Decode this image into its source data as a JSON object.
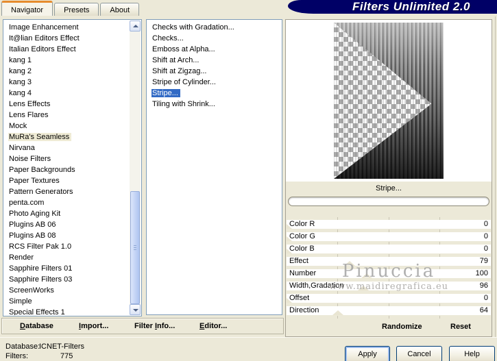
{
  "window": {
    "title": "Filters Unlimited 2.0"
  },
  "tabs": [
    {
      "label": "Navigator",
      "active": true
    },
    {
      "label": "Presets",
      "active": false
    },
    {
      "label": "About",
      "active": false
    }
  ],
  "navigator": {
    "selected": "MuRa's Seamless",
    "items": [
      "Image Enhancement",
      "It@lian Editors Effect",
      "Italian Editors Effect",
      "kang 1",
      "kang 2",
      "kang 3",
      "kang 4",
      "Lens Effects",
      "Lens Flares",
      "Mock",
      "MuRa's Seamless",
      "Nirvana",
      "Noise Filters",
      "Paper Backgrounds",
      "Paper Textures",
      "Pattern Generators",
      "penta.com",
      "Photo Aging Kit",
      "Plugins AB 06",
      "Plugins AB 08",
      "RCS Filter Pak 1.0",
      "Render",
      "Sapphire Filters 01",
      "Sapphire Filters 03",
      "ScreenWorks",
      "Simple",
      "Special Effects 1"
    ]
  },
  "filters": {
    "selected": "Stripe...",
    "items": [
      "Checks with Gradation...",
      "Checks...",
      "Emboss at Alpha...",
      "Shift at Arch...",
      "Shift at Zigzag...",
      "Stripe of Cylinder...",
      "Stripe...",
      "Tiling with Shrink..."
    ]
  },
  "preview": {
    "caption": "Stripe...",
    "progress_percent": 0
  },
  "sliders": {
    "max": 255,
    "items": [
      {
        "label": "Color R",
        "value": 0
      },
      {
        "label": "Color G",
        "value": 0
      },
      {
        "label": "Color B",
        "value": 0
      },
      {
        "label": "Effect",
        "value": 79
      },
      {
        "label": "Number",
        "value": 100
      },
      {
        "label": "Width,Gradation",
        "value": 96
      },
      {
        "label": "Offset",
        "value": 0
      },
      {
        "label": "Direction",
        "value": 64
      }
    ]
  },
  "actions": {
    "randomize": "Randomize",
    "reset": "Reset"
  },
  "footer_buttons": [
    {
      "pre": "",
      "accel": "D",
      "post": "atabase"
    },
    {
      "pre": "",
      "accel": "I",
      "post": "mport..."
    },
    {
      "pre": "Filter ",
      "accel": "I",
      "post": "nfo..."
    },
    {
      "pre": "",
      "accel": "E",
      "post": "ditor..."
    }
  ],
  "status": {
    "database_label": "Database:",
    "database_value": "ICNET-Filters",
    "filters_label": "Filters:",
    "filters_value": "775"
  },
  "dialog_buttons": [
    "Apply",
    "Cancel",
    "Help"
  ],
  "watermark": {
    "line1": "Pinuccia",
    "line2": "www.maidiregrafica.eu"
  },
  "colors": {
    "dialog_bg": "#ECE9D8",
    "banner": "#000066",
    "selection_blue": "#316AC5",
    "selection_tan": "#EFEBD5",
    "tab_highlight": "#E68B2C"
  }
}
